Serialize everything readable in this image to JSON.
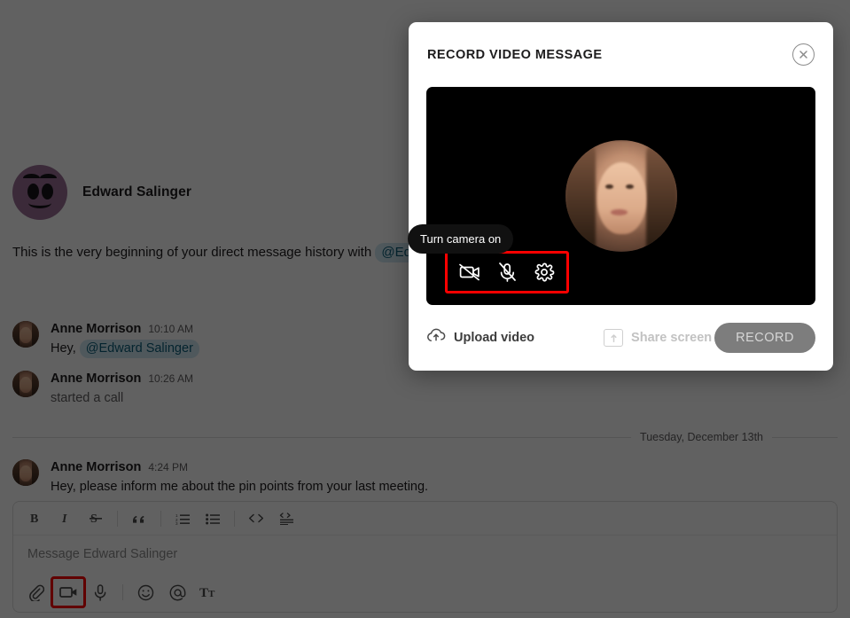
{
  "chat": {
    "intro": {
      "name": "Edward Salinger",
      "text_before": "This is the very beginning of your direct message history with",
      "mention": "@Edward Salinger"
    },
    "messages": [
      {
        "author": "Anne Morrison",
        "time": "10:10 AM",
        "text_before": "Hey,",
        "mention": "@Edward Salinger",
        "muted": false
      },
      {
        "author": "Anne Morrison",
        "time": "10:26 AM",
        "text": "started a call",
        "muted": true
      }
    ],
    "date_divider": "Tuesday, December 13th",
    "last_message": {
      "author": "Anne Morrison",
      "time": "4:24 PM",
      "text": "Hey, please inform me about the pin points from your last meeting."
    }
  },
  "composer": {
    "placeholder": "Message Edward Salinger",
    "toolbar": [
      {
        "name": "bold-icon",
        "label": "B"
      },
      {
        "name": "italic-icon",
        "label": "I"
      },
      {
        "name": "strikethrough-icon",
        "label": "S"
      },
      {
        "name": "blockquote-icon",
        "label": "””"
      },
      {
        "name": "ordered-list-icon",
        "label": "1."
      },
      {
        "name": "bullet-list-icon",
        "label": "•"
      },
      {
        "name": "code-icon",
        "label": "< >"
      },
      {
        "name": "code-block-icon",
        "label": "</>"
      }
    ],
    "actions": [
      {
        "name": "attach-icon",
        "label": "attach"
      },
      {
        "name": "video-message-icon",
        "label": "video message",
        "highlighted": true
      },
      {
        "name": "audio-message-icon",
        "label": "audio message"
      },
      {
        "name": "emoji-icon",
        "label": "emoji"
      },
      {
        "name": "mention-icon",
        "label": "mention"
      },
      {
        "name": "text-format-icon",
        "label": "text formatting"
      }
    ]
  },
  "modal": {
    "title": "RECORD VIDEO MESSAGE",
    "close_label": "✕",
    "tooltip": "Turn camera on",
    "controls": [
      {
        "name": "camera-off-icon",
        "label": "Turn camera on"
      },
      {
        "name": "microphone-off-icon",
        "label": "Turn microphone on"
      },
      {
        "name": "settings-gear-icon",
        "label": "Settings"
      }
    ],
    "upload_label": "Upload video",
    "share_label": "Share screen",
    "record_label": "RECORD"
  },
  "colors": {
    "accent_red": "#ff0000",
    "mention_bg": "#cfe8f2",
    "record_bg": "#7d7d7d",
    "overlay": "rgba(0,0,0,0.62)"
  }
}
